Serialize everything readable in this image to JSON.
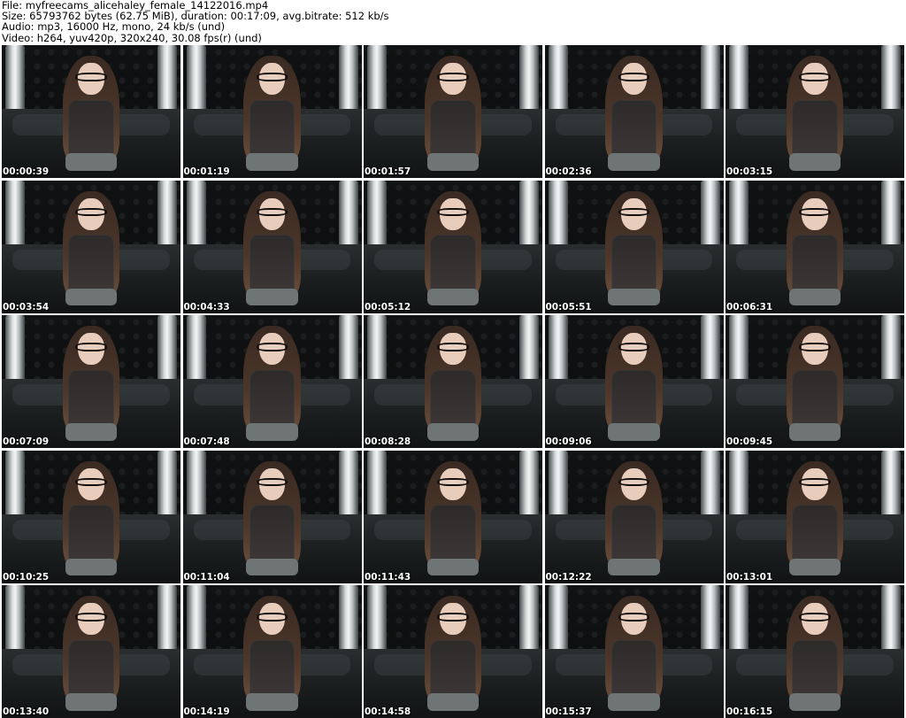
{
  "header": {
    "file": "File: myfreecams_alicehaley_female_14122016.mp4",
    "size": "Size: 65793762 bytes (62.75 MiB), duration: 00:17:09, avg.bitrate: 512 kb/s",
    "audio": "Audio: mp3, 16000 Hz, mono, 24 kb/s (und)",
    "video": "Video: h264, yuv420p, 320x240, 30.08 fps(r) (und)"
  },
  "frames": [
    {
      "timestamp": "00:00:39"
    },
    {
      "timestamp": "00:01:19"
    },
    {
      "timestamp": "00:01:57"
    },
    {
      "timestamp": "00:02:36"
    },
    {
      "timestamp": "00:03:15"
    },
    {
      "timestamp": "00:03:54"
    },
    {
      "timestamp": "00:04:33"
    },
    {
      "timestamp": "00:05:12"
    },
    {
      "timestamp": "00:05:51"
    },
    {
      "timestamp": "00:06:31"
    },
    {
      "timestamp": "00:07:09"
    },
    {
      "timestamp": "00:07:48"
    },
    {
      "timestamp": "00:08:28"
    },
    {
      "timestamp": "00:09:06"
    },
    {
      "timestamp": "00:09:45"
    },
    {
      "timestamp": "00:10:25"
    },
    {
      "timestamp": "00:11:04"
    },
    {
      "timestamp": "00:11:43"
    },
    {
      "timestamp": "00:12:22"
    },
    {
      "timestamp": "00:13:01"
    },
    {
      "timestamp": "00:13:40"
    },
    {
      "timestamp": "00:14:19"
    },
    {
      "timestamp": "00:14:58"
    },
    {
      "timestamp": "00:15:37"
    },
    {
      "timestamp": "00:16:15"
    }
  ]
}
